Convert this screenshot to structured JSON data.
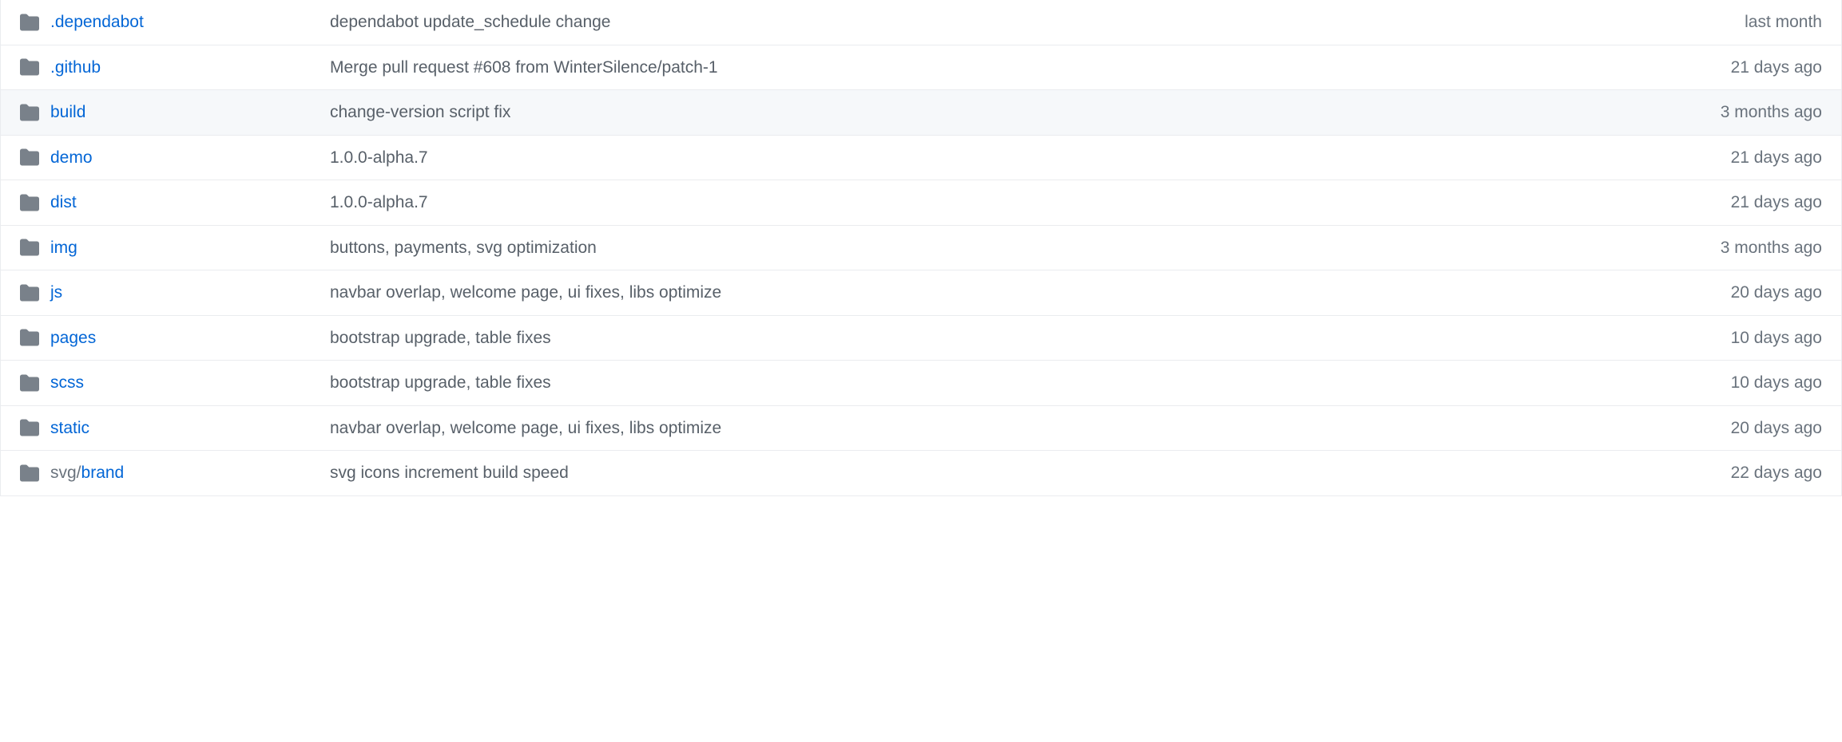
{
  "files": [
    {
      "name": ".dependabot",
      "prefix": "",
      "commit": "dependabot update_schedule change",
      "time": "last month",
      "hovered": false
    },
    {
      "name": ".github",
      "prefix": "",
      "commit": "Merge pull request #608 from WinterSilence/patch-1",
      "time": "21 days ago",
      "hovered": false
    },
    {
      "name": "build",
      "prefix": "",
      "commit": "change-version script fix",
      "time": "3 months ago",
      "hovered": true
    },
    {
      "name": "demo",
      "prefix": "",
      "commit": "1.0.0-alpha.7",
      "time": "21 days ago",
      "hovered": false
    },
    {
      "name": "dist",
      "prefix": "",
      "commit": "1.0.0-alpha.7",
      "time": "21 days ago",
      "hovered": false
    },
    {
      "name": "img",
      "prefix": "",
      "commit": "buttons, payments, svg optimization",
      "time": "3 months ago",
      "hovered": false
    },
    {
      "name": "js",
      "prefix": "",
      "commit": "navbar overlap, welcome page, ui fixes, libs optimize",
      "time": "20 days ago",
      "hovered": false
    },
    {
      "name": "pages",
      "prefix": "",
      "commit": "bootstrap upgrade, table fixes",
      "time": "10 days ago",
      "hovered": false
    },
    {
      "name": "scss",
      "prefix": "",
      "commit": "bootstrap upgrade, table fixes",
      "time": "10 days ago",
      "hovered": false
    },
    {
      "name": "static",
      "prefix": "",
      "commit": "navbar overlap, welcome page, ui fixes, libs optimize",
      "time": "20 days ago",
      "hovered": false
    },
    {
      "name": "brand",
      "prefix": "svg/",
      "commit": "svg icons increment build speed",
      "time": "22 days ago",
      "hovered": false
    }
  ]
}
